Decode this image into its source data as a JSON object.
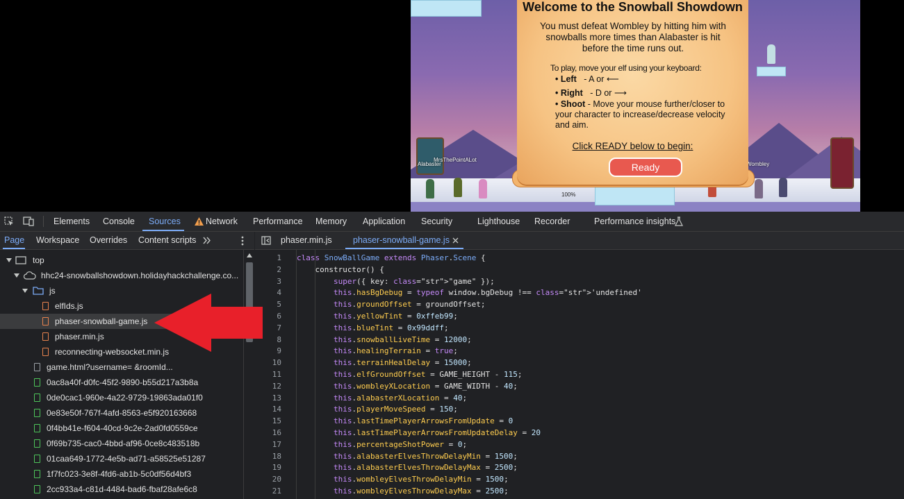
{
  "game": {
    "title": "Welcome to the Snowball Showdown",
    "intro": "You must defeat Wombley by hitting him with snowballs more times than Alabaster is hit before the time runs out.",
    "howto": "To play, move your elf using your keyboard:",
    "controls": [
      {
        "key": "• Left",
        "desc": "- A or ⟵"
      },
      {
        "key": "• Right",
        "desc": "- D or ⟶"
      },
      {
        "key": "• Shoot",
        "desc": "- Move your mouse further/closer to your character to increase/decrease velocity and aim."
      }
    ],
    "click_text": "Click READY below to begin:",
    "ready_label": "Ready",
    "player_name": "MrsThePointALot",
    "left_team": "Alabaster",
    "right_team": "Wombley",
    "power_pct": "100%"
  },
  "devtools": {
    "main_tabs": [
      "Elements",
      "Console",
      "Sources",
      "Network",
      "Performance",
      "Memory",
      "Application",
      "Security",
      "Lighthouse",
      "Recorder",
      "Performance insights"
    ],
    "active_tab": "Sources",
    "nav_tabs": [
      "Page",
      "Workspace",
      "Overrides",
      "Content scripts"
    ],
    "editor_tabs": [
      "phaser.min.js",
      "phaser-snowball-game.js"
    ],
    "tree": [
      {
        "label": "top",
        "indent": 0,
        "kind": "frame"
      },
      {
        "label": "hhc24-snowballshowdown.holidayhackchallenge.co...",
        "indent": 1,
        "kind": "cloud"
      },
      {
        "label": "js",
        "indent": 2,
        "kind": "folder"
      },
      {
        "label": "elfIds.js",
        "indent": 3,
        "kind": "orange"
      },
      {
        "label": "phaser-snowball-game.js",
        "indent": 3,
        "kind": "orange",
        "selected": true
      },
      {
        "label": "phaser.min.js",
        "indent": 3,
        "kind": "orange"
      },
      {
        "label": "reconnecting-websocket.min.js",
        "indent": 3,
        "kind": "orange"
      },
      {
        "label": "game.html?username=                    &roomId...",
        "indent": 2,
        "kind": "grey"
      },
      {
        "label": "0ac8a40f-d0fc-45f2-9890-b55d217a3b8a",
        "indent": 2,
        "kind": "green"
      },
      {
        "label": "0de0cac1-960e-4a22-9729-19863ada01f0",
        "indent": 2,
        "kind": "green"
      },
      {
        "label": "0e83e50f-767f-4afd-8563-e5f920163668",
        "indent": 2,
        "kind": "green"
      },
      {
        "label": "0f4bb41e-f604-40cd-9c2e-2ad0fd0559ce",
        "indent": 2,
        "kind": "green"
      },
      {
        "label": "0f69b735-cac0-4bbd-af96-0ce8c483518b",
        "indent": 2,
        "kind": "green"
      },
      {
        "label": "01caa649-1772-4e5b-ad71-a58525e51287",
        "indent": 2,
        "kind": "green"
      },
      {
        "label": "1f7fc023-3e8f-4fd6-ab1b-5c0df56d4bf3",
        "indent": 2,
        "kind": "green"
      },
      {
        "label": "2cc933a4-c81d-4484-bad6-fbaf28afe6c8",
        "indent": 2,
        "kind": "green"
      }
    ],
    "code_lines": [
      "class SnowBallGame extends Phaser.Scene {",
      "    constructor() {",
      "        super({ key: \"game\" });",
      "        this.hasBgDebug = typeof window.bgDebug !== 'undefined'",
      "        this.groundOffset = groundOffset;",
      "        this.yellowTint = 0xffeb99;",
      "        this.blueTint = 0x99ddff;",
      "        this.snowballLiveTime = 12000;",
      "        this.healingTerrain = true;",
      "        this.terrainHealDelay = 15000;",
      "        this.elfGroundOffset = GAME_HEIGHT - 115;",
      "        this.wombleyXLocation = GAME_WIDTH - 40;",
      "        this.alabasterXLocation = 40;",
      "        this.playerMoveSpeed = 150;",
      "        this.lastTimePlayerArrowsFromUpdate = 0",
      "        this.lastTimePlayerArrowsFromUpdateDelay = 20",
      "        this.percentageShotPower = 0;",
      "        this.alabasterElvesThrowDelayMin = 1500;",
      "        this.alabasterElvesThrowDelayMax = 2500;",
      "        this.wombleyElvesThrowDelayMin = 1500;",
      "        this.wombleyElvesThrowDelayMax = 2500;"
    ],
    "line_numbers": [
      "1",
      "2",
      "3",
      "4",
      "5",
      "6",
      "7",
      "8",
      "9",
      "10",
      "11",
      "12",
      "13",
      "14",
      "15",
      "16",
      "17",
      "18",
      "19",
      "20",
      "21"
    ]
  },
  "colors": {
    "accent": "#7cacf8",
    "arrow": "#e8202a",
    "ready": "#e8594f"
  }
}
